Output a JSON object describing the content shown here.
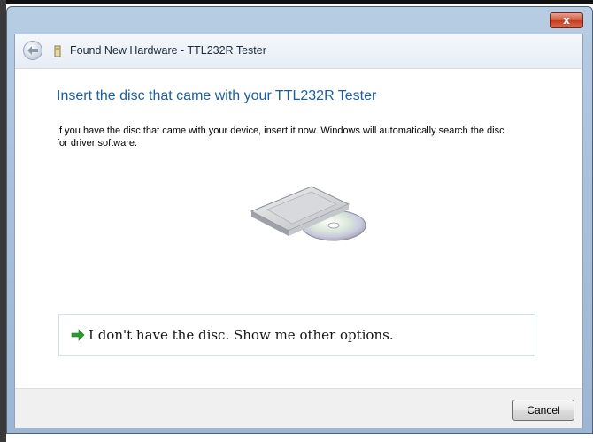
{
  "window": {
    "title": "Found New Hardware - TTL232R Tester",
    "close_label": "x"
  },
  "content": {
    "heading": "Insert the disc that came with your TTL232R Tester",
    "description": "If you have the disc that came with your device, insert it now.  Windows will automatically search the disc for driver software."
  },
  "option": {
    "label": "I don't have the disc.  Show me other options."
  },
  "footer": {
    "cancel_label": "Cancel"
  },
  "icons": [
    "back-arrow-icon",
    "hardware-icon",
    "disc-drive-icon",
    "green-arrow-icon",
    "close-icon"
  ],
  "colors": {
    "heading": "#1b5fa3",
    "arrow": "#2e9b2e",
    "close": "#c8452a"
  }
}
